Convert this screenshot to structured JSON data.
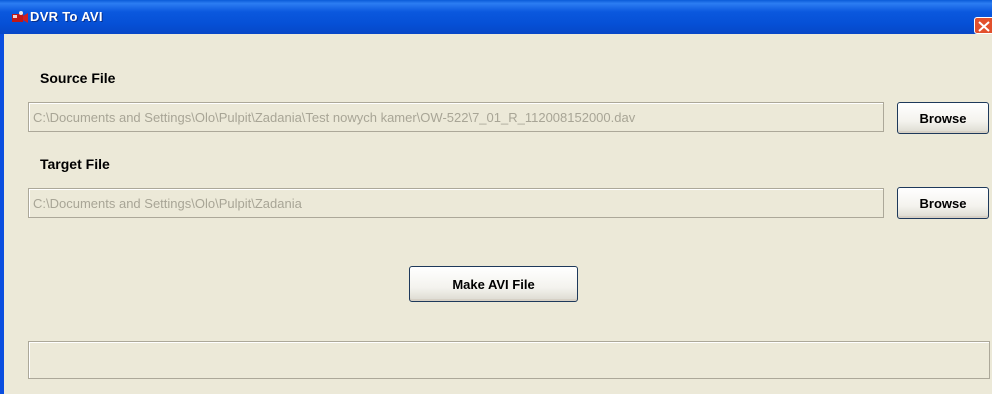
{
  "window": {
    "title": "DVR To AVI"
  },
  "source": {
    "label": "Source File",
    "value": "C:\\Documents and Settings\\Olo\\Pulpit\\Zadania\\Test nowych kamer\\OW-522\\7_01_R_112008152000.dav",
    "browse_label": "Browse"
  },
  "target": {
    "label": "Target File",
    "value": "C:\\Documents and Settings\\Olo\\Pulpit\\Zadania",
    "browse_label": "Browse"
  },
  "make_button_label": "Make AVI File",
  "colors": {
    "titlebar": "#0a58de",
    "face": "#ece9d8",
    "disabled_text": "#a8a596",
    "close": "#e2502c"
  },
  "icons": {
    "app": "dvr-app-icon",
    "close": "close-icon"
  }
}
